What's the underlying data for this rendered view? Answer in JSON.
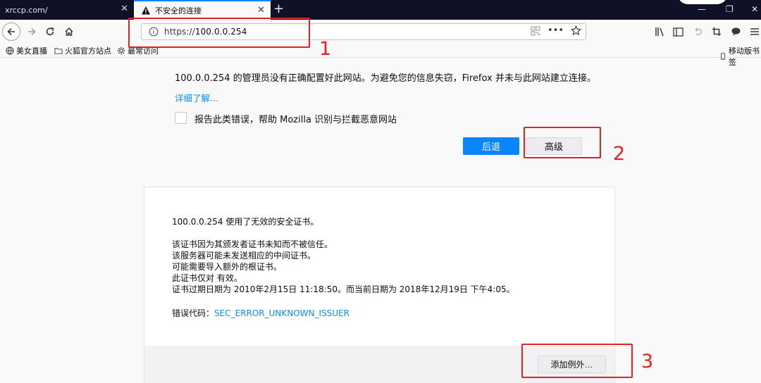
{
  "tabs": [
    {
      "title": "xrccp.com/",
      "active": false
    },
    {
      "title": "不安全的连接",
      "active": true
    }
  ],
  "url": {
    "scheme": "https://",
    "host": "100.0.0.254"
  },
  "bookmarks": [
    {
      "label": "美女直播",
      "icon": "globe-icon"
    },
    {
      "label": "火狐官方站点",
      "icon": "folder-icon"
    },
    {
      "label": "最常访问",
      "icon": "gear-icon"
    },
    {
      "label": "移动版书签",
      "icon": "mobile-icon"
    }
  ],
  "error_page": {
    "main_message": "100.0.0.254 的管理员没有正确配置好此网站。为避免您的信息失窃，Firefox 并未与此网站建立连接。",
    "learn_more": "详细了解…",
    "report_label": "报告此类错误，帮助 Mozilla 识别与拦截恶意网站",
    "go_back": "后退",
    "advanced": "高级"
  },
  "advanced_panel": {
    "line1": "100.0.0.254 使用了无效的安全证书。",
    "line2": "该证书因为其颁发者证书未知而不被信任。",
    "line3": "该服务器可能未发送相应的中间证书。",
    "line4": "可能需要导入额外的根证书。",
    "line5": "此证书仅对  有效。",
    "line6": "证书过期日期为 2010年2月15日 11:18:50。而当前日期为 2018年12月19日 下午4:05。",
    "error_code_label": "错误代码：",
    "error_code": "SEC_ERROR_UNKNOWN_ISSUER",
    "add_exception": "添加例外…"
  },
  "annotations": [
    "1",
    "2",
    "3"
  ],
  "colors": {
    "accent": "#0a84ff",
    "annotation": "#e52222",
    "link": "#0a8dff"
  }
}
